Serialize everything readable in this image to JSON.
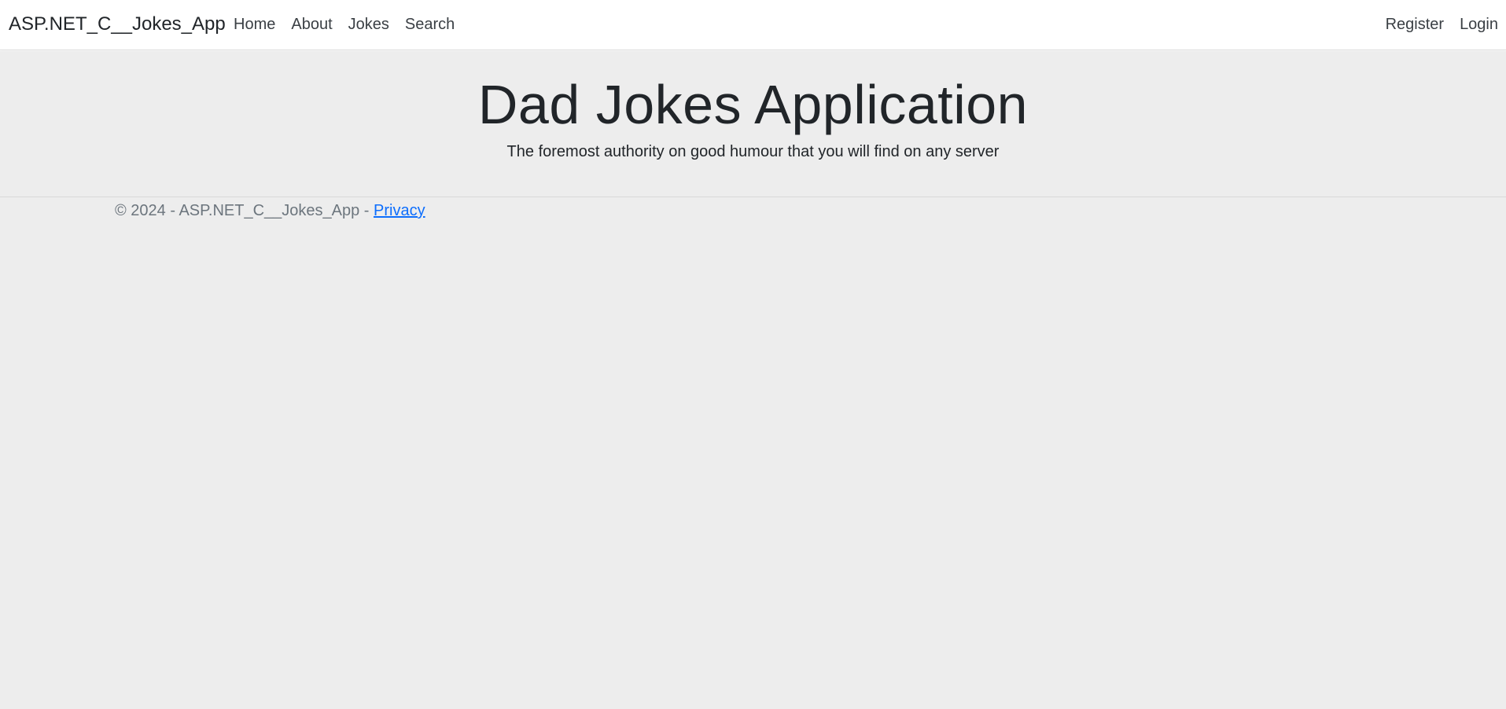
{
  "navbar": {
    "brand": "ASP.NET_C__Jokes_App",
    "left_links": [
      "Home",
      "About",
      "Jokes",
      "Search"
    ],
    "right_links": [
      "Register",
      "Login"
    ]
  },
  "hero": {
    "title": "Dad Jokes Application",
    "subtitle": "The foremost authority on good humour that you will find on any server"
  },
  "footer": {
    "copyright": "© 2024 - ASP.NET_C__Jokes_App - ",
    "privacy_link": "Privacy"
  },
  "colors": {
    "page_background": "#ededed",
    "navbar_background": "#ffffff",
    "link_accent": "#0d6efd",
    "footer_text": "#6c757d"
  }
}
